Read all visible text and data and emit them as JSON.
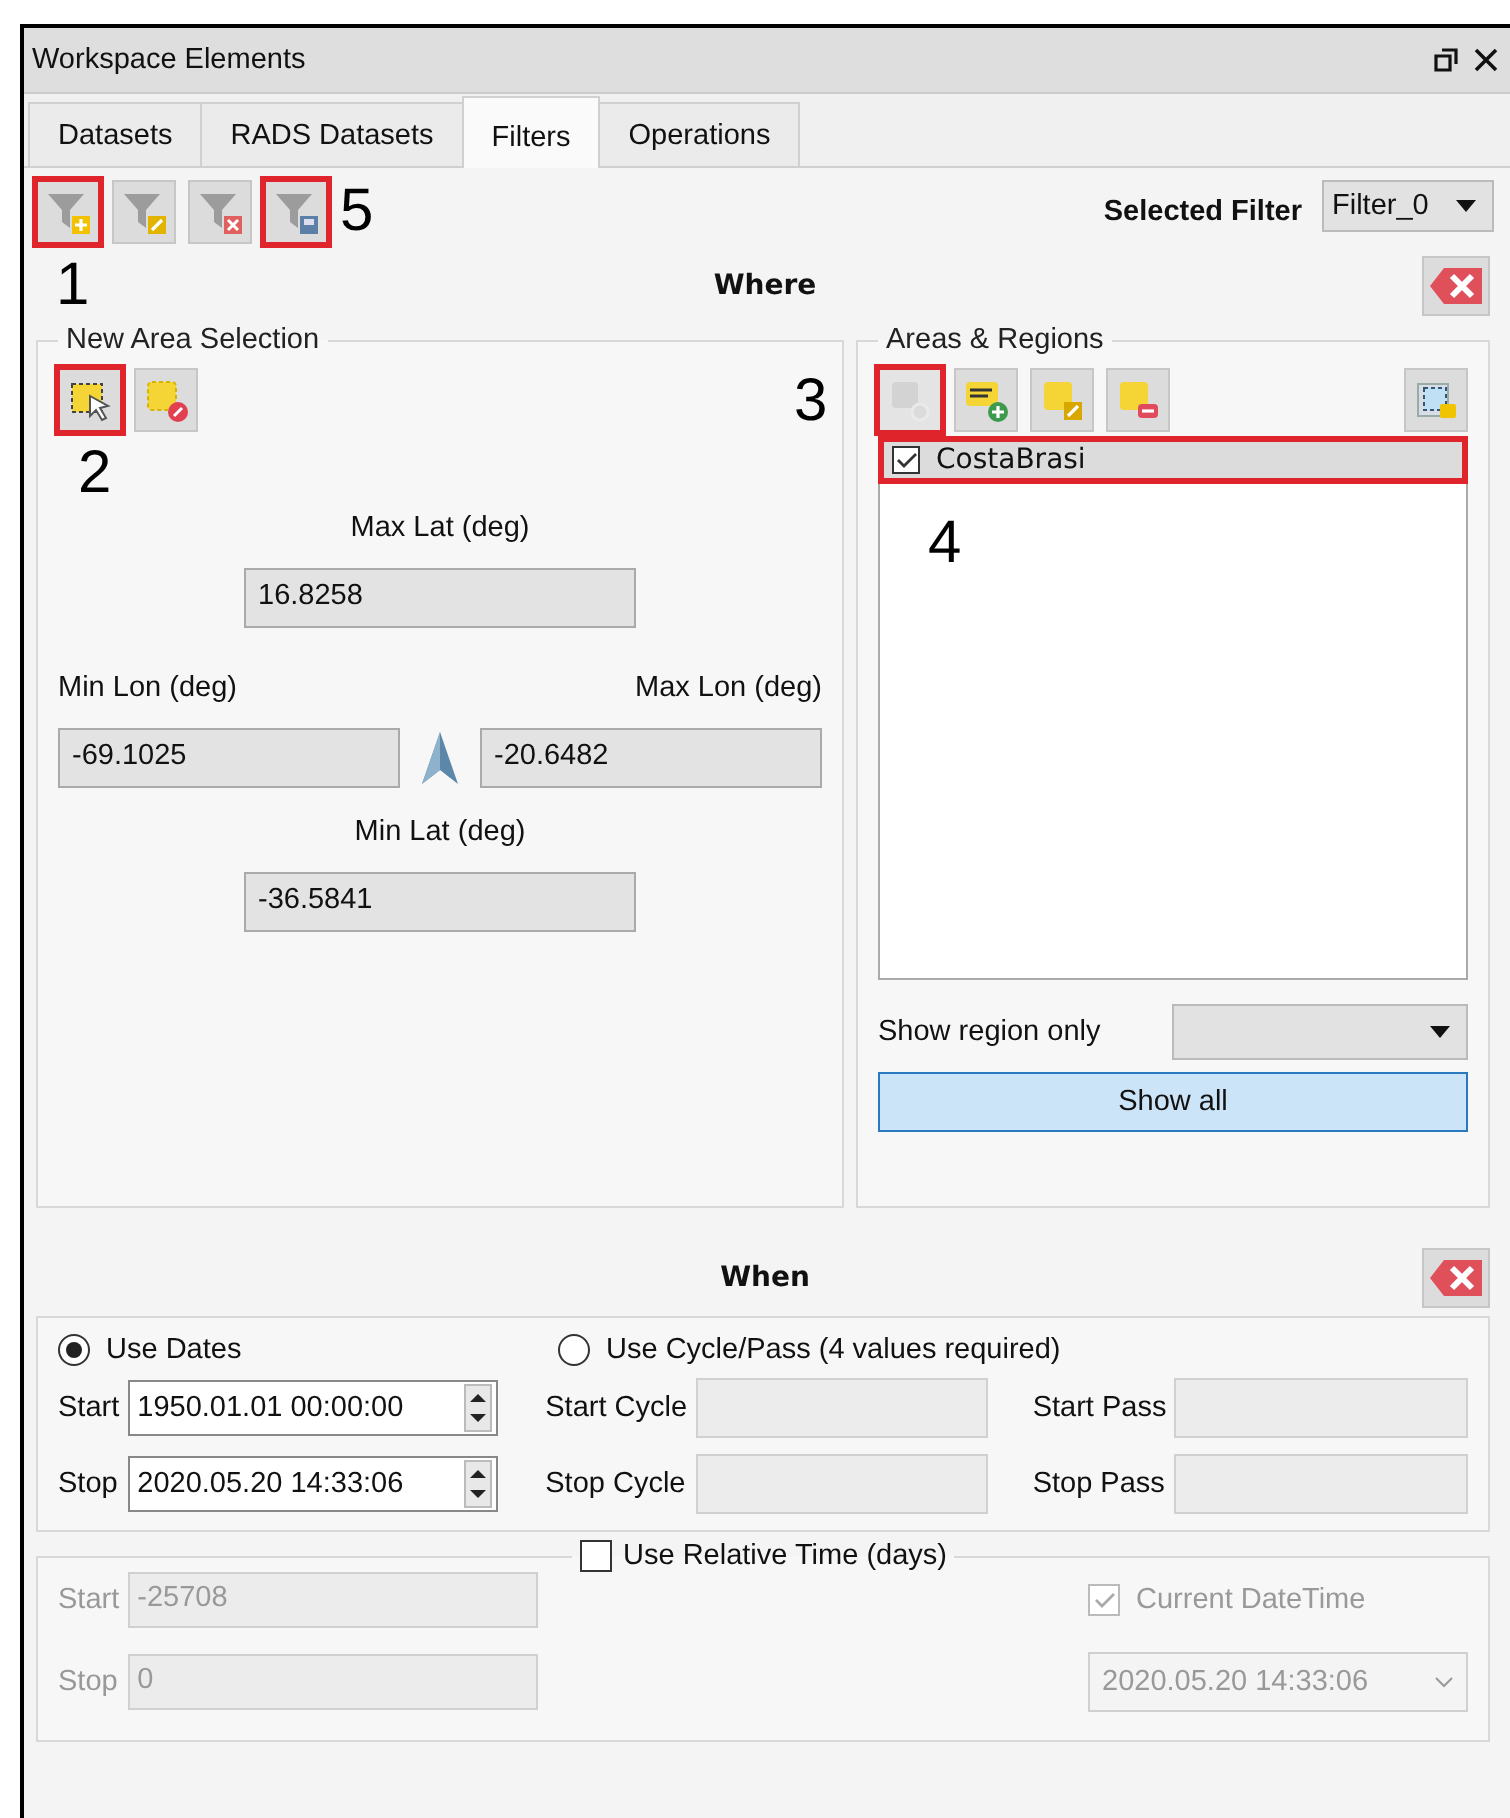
{
  "window": {
    "title": "Workspace Elements"
  },
  "tabs": [
    {
      "label": "Datasets",
      "selected": false
    },
    {
      "label": "RADS Datasets",
      "selected": false
    },
    {
      "label": "Filters",
      "selected": true
    },
    {
      "label": "Operations",
      "selected": false
    }
  ],
  "filter_toolbar": [
    {
      "kind": "add",
      "highlighted": true,
      "callout": "1"
    },
    {
      "kind": "edit",
      "highlighted": false
    },
    {
      "kind": "delete",
      "highlighted": false
    },
    {
      "kind": "save",
      "highlighted": true,
      "callout": "5"
    }
  ],
  "selected_filter": {
    "label": "Selected Filter",
    "value": "Filter_0"
  },
  "where": {
    "title": "Where",
    "new_area": {
      "title": "New Area Selection",
      "buttons": [
        {
          "kind": "select-area",
          "highlighted": true,
          "callout": "2"
        },
        {
          "kind": "clear-area",
          "highlighted": false
        }
      ],
      "max_lat": {
        "label": "Max Lat (deg)",
        "value": "16.8258"
      },
      "min_lon": {
        "label": "Min Lon (deg)",
        "value": "-69.1025"
      },
      "max_lon": {
        "label": "Max Lon (deg)",
        "value": "-20.6482"
      },
      "min_lat": {
        "label": "Min Lat (deg)",
        "value": "-36.5841"
      }
    },
    "areas": {
      "title": "Areas & Regions",
      "buttons": [
        {
          "kind": "import",
          "highlighted": true,
          "disabled": true,
          "callout": "3"
        },
        {
          "kind": "kml",
          "highlighted": false,
          "disabled": false
        },
        {
          "kind": "edit-area",
          "highlighted": false,
          "disabled": false
        },
        {
          "kind": "remove-area",
          "highlighted": false,
          "disabled": false
        }
      ],
      "map_button": {
        "kind": "map"
      },
      "items": [
        {
          "name": "CostaBrasi",
          "checked": true,
          "selected": true,
          "highlighted": true,
          "callout": "4"
        }
      ],
      "show_region_only": {
        "label": "Show region only"
      },
      "show_all": "Show all"
    }
  },
  "when": {
    "title": "When",
    "modes": [
      {
        "label": "Use Dates",
        "selected": true
      },
      {
        "label": "Use Cycle/Pass (4 values required)",
        "selected": false
      }
    ],
    "dates": [
      {
        "label": "Start",
        "value": "1950.01.01 00:00:00"
      },
      {
        "label": "Stop",
        "value": "2020.05.20 14:33:06"
      }
    ],
    "cycles": [
      {
        "label": "Start Cycle"
      },
      {
        "label": "Start Pass"
      },
      {
        "label": "Stop Cycle"
      },
      {
        "label": "Stop Pass"
      }
    ],
    "relative": {
      "label": "Use Relative Time (days)",
      "checked": false,
      "start": {
        "label": "Start",
        "value": "-25708"
      },
      "stop": {
        "label": "Stop",
        "value": "0"
      },
      "current_datetime": {
        "label": "Current DateTime",
        "checked": true
      },
      "datetime": "2020.05.20 14:33:06"
    }
  }
}
